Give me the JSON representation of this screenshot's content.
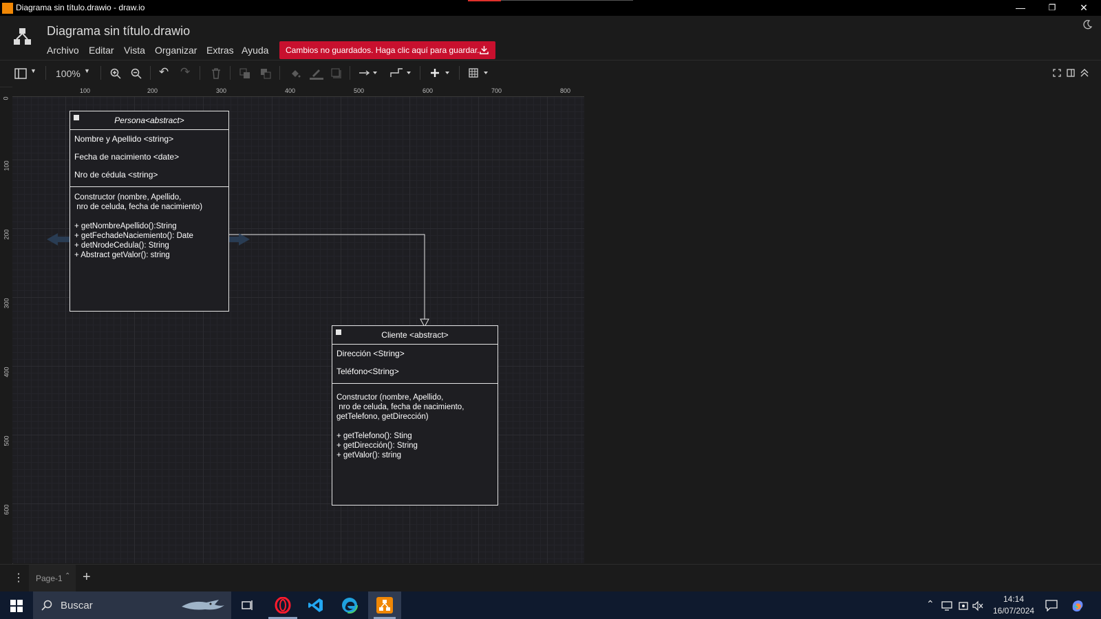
{
  "window": {
    "title": "Diagrama sin título.drawio - draw.io",
    "controls": [
      "minimize",
      "restore",
      "close"
    ]
  },
  "header": {
    "doc_title": "Diagrama sin título.drawio",
    "menu": [
      "Archivo",
      "Editar",
      "Vista",
      "Organizar",
      "Extras",
      "Ayuda"
    ],
    "save_banner": "Cambios no guardados. Haga clic aquí para guardar.",
    "theme_icon": "moon-icon"
  },
  "toolbar": {
    "zoom": "100%",
    "icons": [
      "format-panel-icon",
      "zoom-in-icon",
      "zoom-out-icon",
      "undo-icon",
      "redo-icon",
      "delete-icon",
      "to-front-icon",
      "to-back-icon",
      "fill-color-icon",
      "line-color-icon",
      "shadow-icon",
      "connection-icon",
      "waypoints-icon",
      "insert-icon",
      "table-icon",
      "fullscreen-icon",
      "format-toggle-icon",
      "collapse-icon"
    ]
  },
  "rulers": {
    "horizontal": [
      "100",
      "200",
      "300",
      "400",
      "500",
      "600",
      "700",
      "800"
    ],
    "vertical": [
      "0",
      "100",
      "200",
      "300",
      "400",
      "500",
      "600"
    ]
  },
  "diagram": {
    "persona": {
      "title": "Persona<abstract>",
      "attributes": [
        "Nombre y Apellido <string>",
        "Fecha de nacimiento <date>",
        "Nro de cédula <string>"
      ],
      "operations": "Constructor (nombre, Apellido,\n nro de celuda, fecha de nacimiento)\n\n+ getNombreApellido():String\n+ getFechadeNaciemiento(): Date\n+ detNrodeCedula(): String\n+ Abstract getValor(): string"
    },
    "cliente": {
      "title": "Cliente <abstract>",
      "attributes": [
        "Dirección <String>",
        "Teléfono<String>"
      ],
      "operations": "Constructor (nombre, Apellido,\n nro de celuda, fecha de nacimiento,\ngetTelefono, getDirección)\n\n+ getTelefono(): Sting\n+ getDirección(): String\n+ getValor(): string"
    }
  },
  "pages": {
    "tab": "Page-1",
    "add": "+"
  },
  "taskbar": {
    "search_placeholder": "Buscar",
    "time": "14:14",
    "date": "16/07/2024"
  },
  "colors": {
    "save_banner": "#c8102e",
    "canvas": "#1e1e22",
    "taskbar": "#0f1a2e",
    "drawio_orange": "#f08705"
  }
}
